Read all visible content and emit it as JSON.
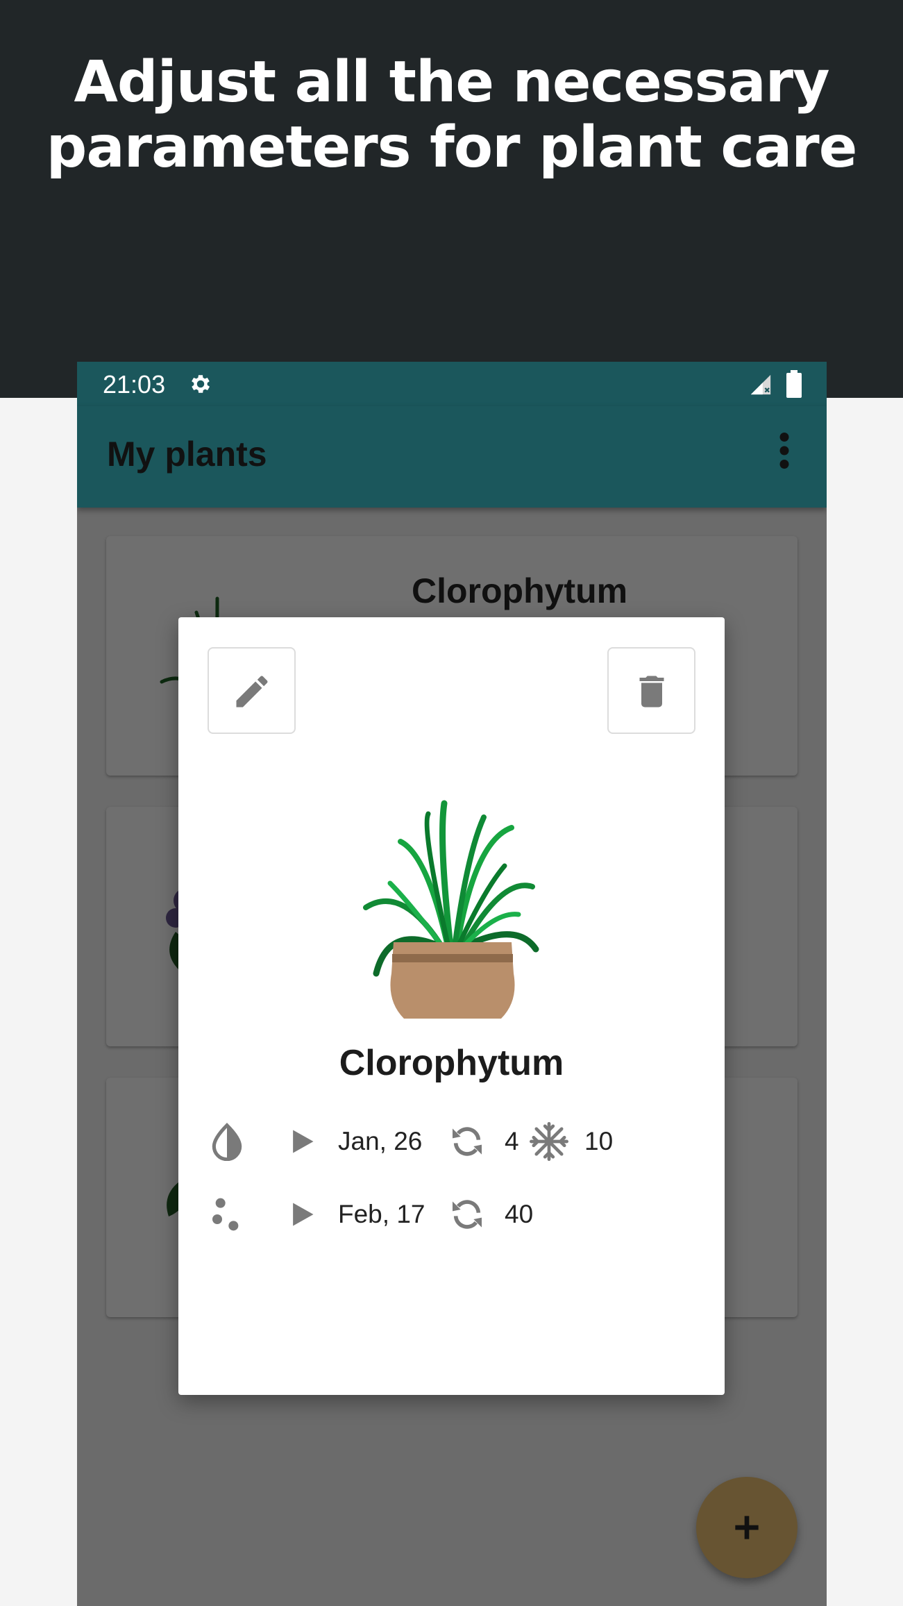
{
  "headline": {
    "line1": "Adjust all the necessary",
    "line2": "parameters for plant care"
  },
  "status_bar": {
    "time": "21:03",
    "icons": [
      "gear-icon",
      "signal-icon",
      "battery-icon"
    ]
  },
  "app_bar": {
    "title": "My plants",
    "menu_icon": "more-vert-icon"
  },
  "plant_list": {
    "cards": [
      {
        "name": "Clorophytum",
        "image": "clorophytum-plant"
      },
      {
        "name": "",
        "image": "violet-plant"
      },
      {
        "name": "",
        "image": "green-plant"
      }
    ]
  },
  "dialog": {
    "edit_icon": "pencil-icon",
    "delete_icon": "trash-icon",
    "plant_name": "Clorophytum",
    "watering": {
      "icon": "water-drop-icon",
      "next_date": "Jan, 26",
      "interval": "4",
      "winter_interval": "10"
    },
    "fertilizing": {
      "icon": "fertilizer-icon",
      "next_date": "Feb, 17",
      "interval": "40"
    }
  },
  "fab": {
    "icon": "plus-icon"
  },
  "colors": {
    "top_band": "#212628",
    "app_bar": "#1b575c",
    "scrim": "#6b6b6b",
    "fab": "#675432",
    "icon_gray": "#7a7a7a"
  }
}
